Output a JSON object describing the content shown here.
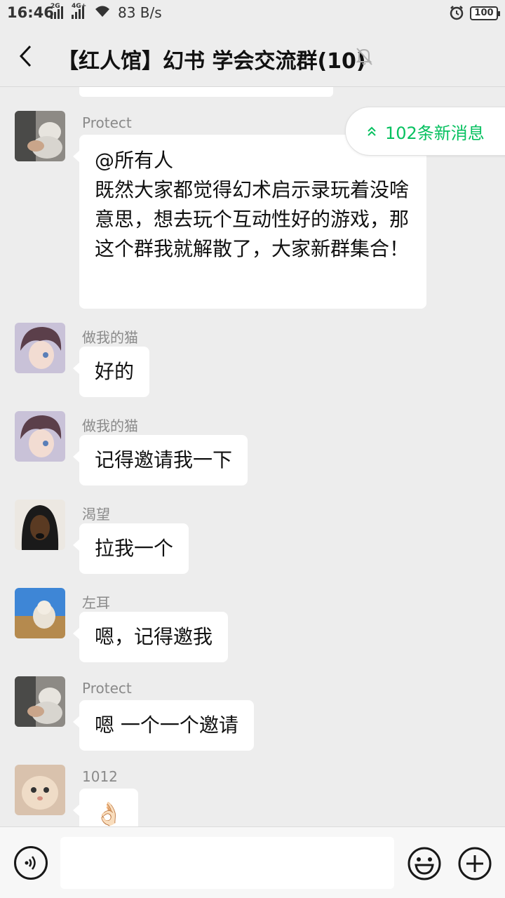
{
  "status": {
    "time": "16:46",
    "net1": "2G",
    "net2": "4G+",
    "speed": "83 B/s",
    "battery": "100"
  },
  "header": {
    "back_icon": "chevron-left-icon",
    "title": "【红人馆】幻书 学会交流群(10)",
    "mute_icon": "bell-off-icon"
  },
  "new_messages": {
    "label": "102条新消息",
    "icon": "double-chevron-up-icon",
    "color": "#07c160"
  },
  "messages": [
    {
      "sender": "Protect",
      "text": "@所有人\n既然大家都觉得幻术启示录玩着没啥意思，想去玩个互动性好的游戏，那这个群我就解散了，大家新群集合！"
    },
    {
      "sender": "做我的猫",
      "text": "好的"
    },
    {
      "sender": "做我的猫",
      "text": "记得邀请我一下"
    },
    {
      "sender": "渴望",
      "text": "拉我一个"
    },
    {
      "sender": "左耳",
      "text": "嗯，记得邀我"
    },
    {
      "sender": "Protect",
      "text": "嗯 一个一个邀请"
    },
    {
      "sender": "1012",
      "text": "👌🏻"
    }
  ],
  "input": {
    "value": "",
    "voice_icon": "voice-icon",
    "emoji_icon": "emoji-icon",
    "plus_icon": "plus-circle-icon"
  }
}
